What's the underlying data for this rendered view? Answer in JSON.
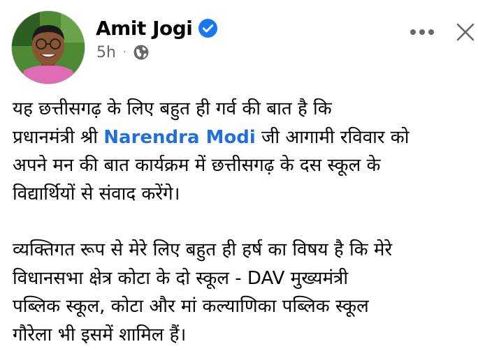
{
  "post": {
    "author": {
      "name": "Amit Jogi",
      "verified_icon": "verified-badge-icon",
      "avatar_icon": "profile-photo"
    },
    "meta": {
      "time": "5h",
      "separator": "·",
      "audience_icon": "globe-icon"
    },
    "actions": {
      "more_icon": "more-options-icon",
      "close_icon": "close-icon"
    },
    "body": {
      "paragraph_1": {
        "before_mention": "यह छत्तीसगढ़ के लिए बहुत ही गर्व की बात है कि\nप्रधानमंत्री श्री ",
        "mention": "Narendra Modi",
        "after_mention": " जी आगामी रविवार को\nअपने मन की बात कार्यक्रम में छत्तीसगढ़ के दस स्कूल के\nविद्यार्थियों से संवाद करेंगे।"
      },
      "paragraph_2": "व्यक्तिगत रूप से मेरे लिए बहुत ही हर्ष का विषय है कि मेरे\nविधानसभा क्षेत्र कोटा के दो स्कूल - DAV मुख्यमंत्री\nपब्लिक स्कूल, कोटा और मां कल्याणिका पब्लिक स्कूल\nगौरेला भी इसमें शामिल हैं।"
    }
  },
  "colors": {
    "verified_blue": "#1877f2",
    "mention_blue": "#216fdb",
    "meta_gray": "#65676b",
    "text": "#050505"
  }
}
